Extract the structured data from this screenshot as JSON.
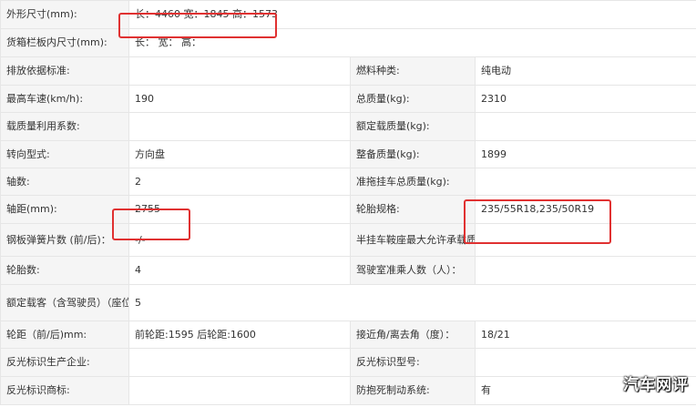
{
  "rows": [
    {
      "l1": "外形尺寸(mm):",
      "v1": "长：4460 宽：1845 高：1573"
    },
    {
      "l1": "货箱栏板内尺寸(mm):",
      "v1": "长：   宽：   高："
    },
    {
      "l1": "排放依据标准:",
      "v1": "",
      "l2": "燃料种类:",
      "v2": "纯电动"
    },
    {
      "l1": "最高车速(km/h):",
      "v1": "190",
      "l2": "总质量(kg):",
      "v2": "2310"
    },
    {
      "l1": "载质量利用系数:",
      "v1": "",
      "l2": "额定载质量(kg):",
      "v2": ""
    },
    {
      "l1": "转向型式:",
      "v1": "方向盘",
      "l2": "整备质量(kg):",
      "v2": "1899"
    },
    {
      "l1": "轴数:",
      "v1": "2",
      "l2": "准拖挂车总质量(kg):",
      "v2": ""
    },
    {
      "l1": "轴距(mm):",
      "v1": "2755",
      "l2": "轮胎规格:",
      "v2": "235/55R18,235/50R19"
    },
    {
      "l1": "钢板弹簧片数 (前/后)：",
      "v1": "-/-",
      "l2": "半挂车鞍座最大允许承载质量(kg):",
      "v2": ""
    },
    {
      "l1": "轮胎数:",
      "v1": "4",
      "l2": "驾驶室准乘人数（人）：",
      "v2": ""
    },
    {
      "l1": "额定载客（含驾驶员）（座位数）：",
      "v1": "5"
    },
    {
      "l1": "轮距（前/后)mm:",
      "v1": "前轮距:1595 后轮距:1600",
      "l2": "接近角/离去角（度）：",
      "v2": "18/21"
    },
    {
      "l1": "反光标识生产企业:",
      "v1": "",
      "l2": "反光标识型号:",
      "v2": ""
    },
    {
      "l1": "反光标识商标:",
      "v1": "",
      "l2": "防抱死制动系统:",
      "v2": "有"
    }
  ],
  "watermark": "汽车网评",
  "highlight_color": "#e03131"
}
